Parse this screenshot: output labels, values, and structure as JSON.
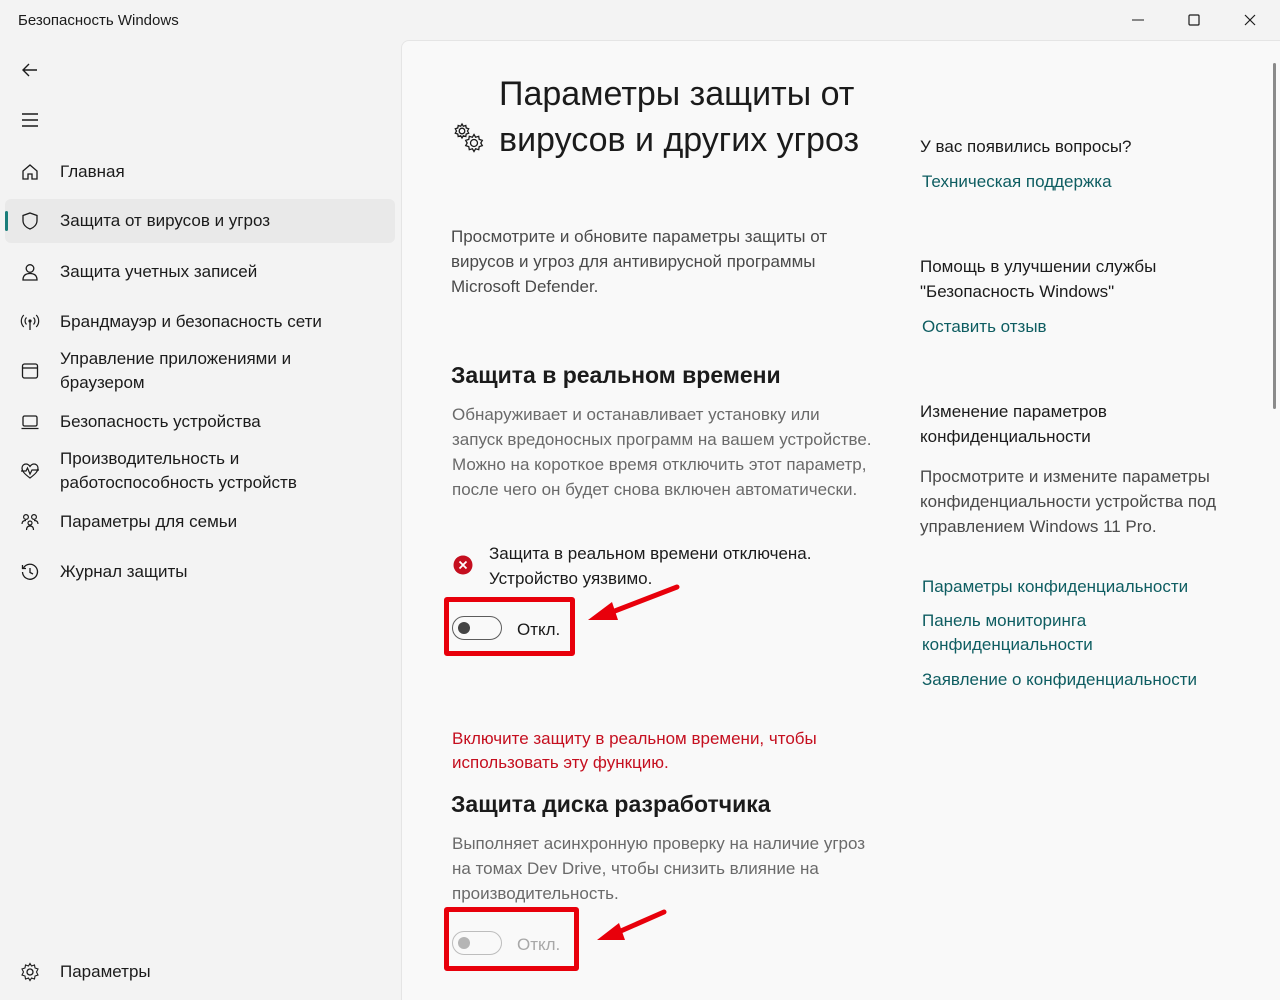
{
  "window": {
    "title": "Безопасность Windows",
    "controls": [
      "minimize-icon",
      "maximize-icon",
      "close-icon"
    ]
  },
  "sidebar": {
    "back_icon": "back-arrow-icon",
    "menu_icon": "hamburger-icon",
    "items": [
      {
        "label": "Главная",
        "icon": "home-icon"
      },
      {
        "label": "Защита от вирусов и угроз",
        "icon": "shield-icon",
        "selected": true
      },
      {
        "label": "Защита учетных записей",
        "icon": "person-icon"
      },
      {
        "label": "Брандмауэр и безопасность сети",
        "icon": "wifi-antenna-icon"
      },
      {
        "label": "Управление приложениями и браузером",
        "icon": "app-window-icon"
      },
      {
        "label": "Безопасность устройства",
        "icon": "laptop-icon"
      },
      {
        "label": "Производительность и работоспособность устройств",
        "icon": "heart-pulse-icon"
      },
      {
        "label": "Параметры для семьи",
        "icon": "family-icon"
      },
      {
        "label": "Журнал защиты",
        "icon": "history-icon"
      }
    ],
    "settings": {
      "label": "Параметры",
      "icon": "gear-icon"
    }
  },
  "main": {
    "title": "Параметры защиты от вирусов и других угроз",
    "title_icon": "gears-icon",
    "description": "Просмотрите и обновите параметры защиты от вирусов и угроз для антивирусной программы Microsoft Defender.",
    "realtime": {
      "heading": "Защита в реальном времени",
      "description": "Обнаруживает и останавливает установку или запуск вредоносных программ на вашем устройстве. Можно на короткое время отключить этот параметр, после чего он будет снова включен автоматически.",
      "warning": "Защита в реальном времени отключена. Устройство уязвимо.",
      "toggle_label": "Откл.",
      "toggle_on": false
    },
    "devdrive": {
      "notice": "Включите защиту в реальном времени, чтобы использовать эту функцию.",
      "heading": "Защита диска разработчика",
      "description": "Выполняет асинхронную проверку на наличие угроз на томах Dev Drive, чтобы снизить влияние на производительность.",
      "toggle_label": "Откл.",
      "toggle_on": false,
      "toggle_disabled": true
    },
    "colors": {
      "accent": "#1a7d7a",
      "link": "#0e5d61",
      "alert": "#c50f1f",
      "highlight": "#e8000b"
    }
  },
  "aside": {
    "questions_heading": "У вас появились вопросы?",
    "support_link": "Техническая поддержка",
    "improve_heading": "Помощь в улучшении службы \"Безопасность Windows\"",
    "feedback_link": "Оставить отзыв",
    "privacy_heading": "Изменение параметров конфиденциальности",
    "privacy_text": "Просмотрите и измените параметры конфиденциальности устройства под управлением Windows 11 Pro.",
    "privacy_links": [
      "Параметры конфиденциальности",
      "Панель мониторинга конфиденциальности",
      "Заявление о конфиденциальности"
    ]
  }
}
